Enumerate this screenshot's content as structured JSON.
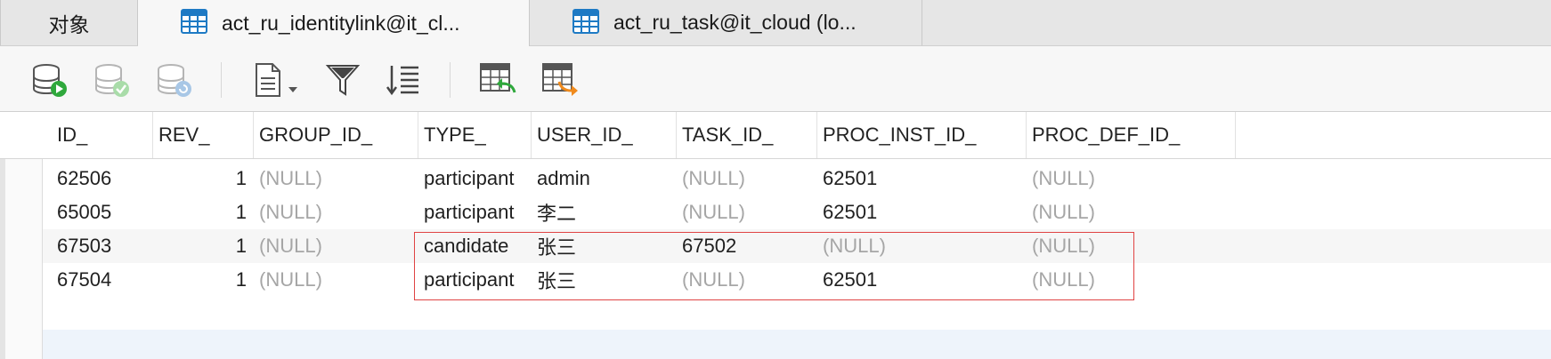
{
  "tabs": [
    {
      "label": "对象"
    },
    {
      "label": "act_ru_identitylink@it_cl..."
    },
    {
      "label": "act_ru_task@it_cloud (lo..."
    }
  ],
  "toolbar": {
    "buttons": [
      "db-run-icon",
      "db-commit-icon",
      "db-refresh-icon",
      "document-icon",
      "filter-icon",
      "sort-icon",
      "import-table-icon",
      "export-table-icon"
    ]
  },
  "table": {
    "columns": [
      "ID_",
      "REV_",
      "GROUP_ID_",
      "TYPE_",
      "USER_ID_",
      "TASK_ID_",
      "PROC_INST_ID_",
      "PROC_DEF_ID_"
    ],
    "rows": [
      [
        "62506",
        "1",
        "(NULL)",
        "participant",
        "admin",
        "(NULL)",
        "62501",
        "(NULL)"
      ],
      [
        "65005",
        "1",
        "(NULL)",
        "participant",
        "李二",
        "(NULL)",
        "62501",
        "(NULL)"
      ],
      [
        "67503",
        "1",
        "(NULL)",
        "candidate",
        "张三",
        "67502",
        "(NULL)",
        "(NULL)"
      ],
      [
        "67504",
        "1",
        "(NULL)",
        "participant",
        "张三",
        "(NULL)",
        "62501",
        "(NULL)"
      ]
    ]
  },
  "colors": {
    "highlight": "#e04343",
    "null_text": "#a6a6a6",
    "tab_icon": "#1e7ac4"
  }
}
